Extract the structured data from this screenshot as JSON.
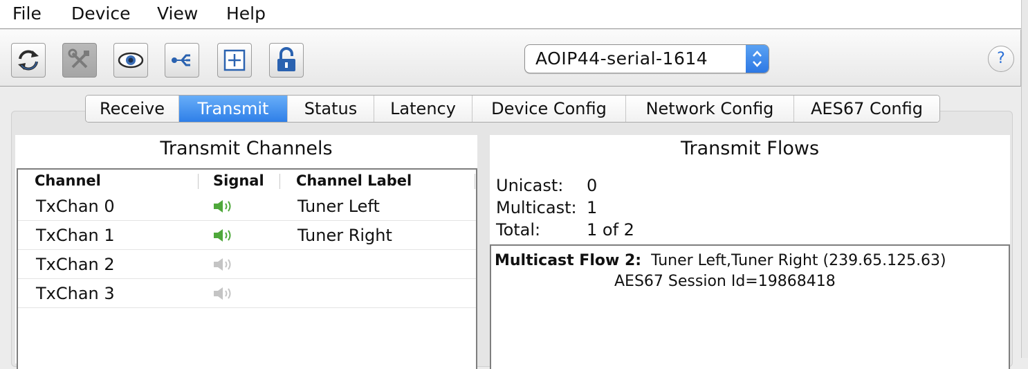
{
  "menu": {
    "items": [
      {
        "label": "File"
      },
      {
        "label": "Device"
      },
      {
        "label": "View"
      },
      {
        "label": "Help"
      }
    ]
  },
  "toolbar": {
    "buttons": [
      {
        "icon": "refresh-icon",
        "enabled": true
      },
      {
        "icon": "tools-icon",
        "enabled": false
      },
      {
        "icon": "eye-icon",
        "enabled": true
      },
      {
        "icon": "network-icon",
        "enabled": true
      },
      {
        "icon": "add-window-icon",
        "enabled": true
      },
      {
        "icon": "unlock-icon",
        "enabled": true
      }
    ],
    "device_select_value": "AOIP44-serial-1614",
    "help_label": "?"
  },
  "tabs": [
    {
      "label": "Receive"
    },
    {
      "label": "Transmit",
      "active": true
    },
    {
      "label": "Status"
    },
    {
      "label": "Latency"
    },
    {
      "label": "Device Config"
    },
    {
      "label": "Network Config"
    },
    {
      "label": "AES67 Config"
    }
  ],
  "transmit_channels": {
    "title": "Transmit Channels",
    "columns": [
      "Channel",
      "Signal",
      "Channel Label"
    ],
    "rows": [
      {
        "channel": "TxChan 0",
        "signal": "active",
        "label": "Tuner Left"
      },
      {
        "channel": "TxChan 1",
        "signal": "active",
        "label": "Tuner Right"
      },
      {
        "channel": "TxChan 2",
        "signal": "inactive",
        "label": ""
      },
      {
        "channel": "TxChan 3",
        "signal": "inactive",
        "label": ""
      }
    ]
  },
  "transmit_flows": {
    "title": "Transmit Flows",
    "unicast_label": "Unicast:",
    "unicast_value": "0",
    "multicast_label": "Multicast:",
    "multicast_value": "1",
    "total_label": "Total:",
    "total_value": "1 of 2",
    "flows": [
      {
        "name": "Multicast Flow 2:",
        "detail": "Tuner Left,Tuner Right (239.65.125.63)",
        "session": "AES67 Session Id=19868418"
      }
    ]
  },
  "colors": {
    "accent": "#2f7fe8",
    "signal_active": "#4fa83b",
    "signal_inactive": "#c4c4c4"
  }
}
